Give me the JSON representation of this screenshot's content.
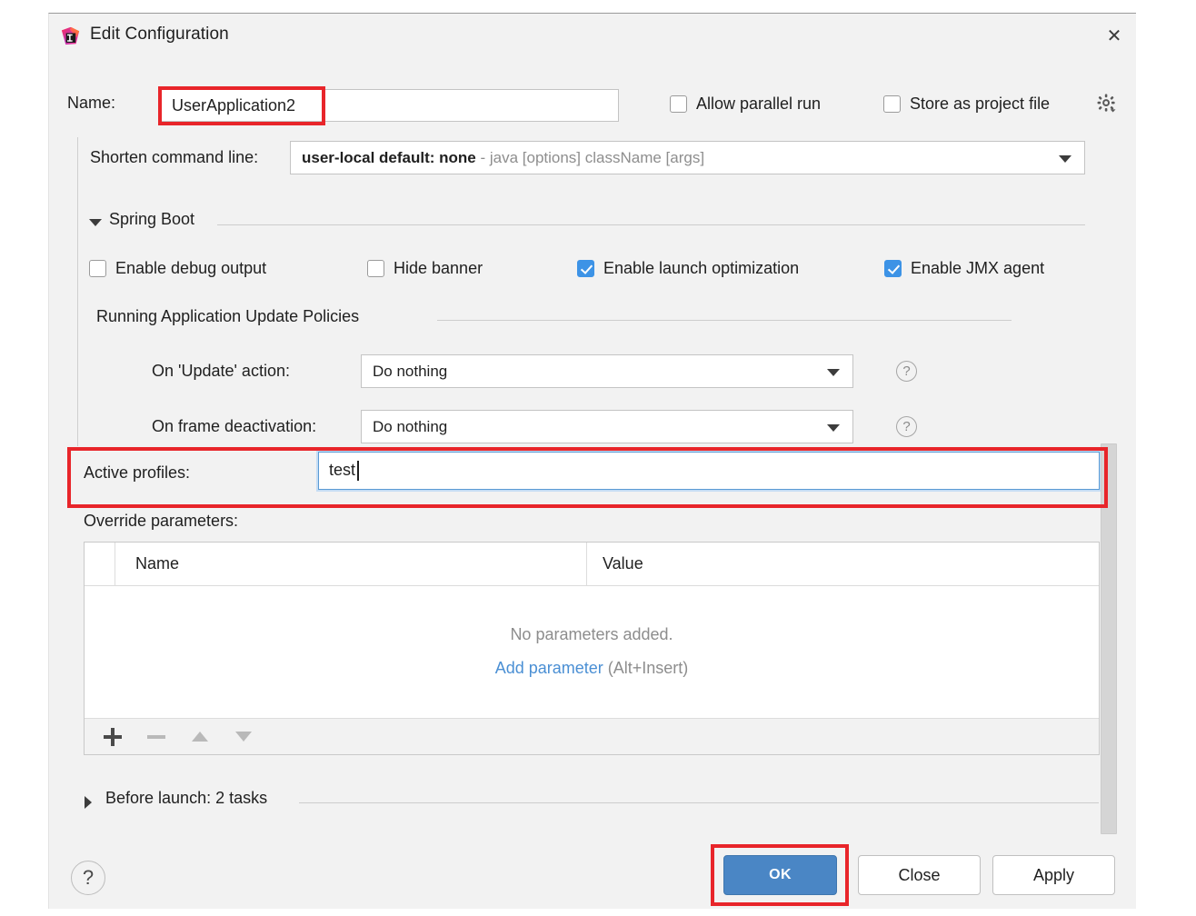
{
  "dialog": {
    "title": "Edit Configuration",
    "app_icon": "intellij-idea-icon",
    "close_label": "✕"
  },
  "name_row": {
    "label": "Name:",
    "value": "UserApplication2",
    "allow_parallel_run": {
      "label": "Allow parallel run",
      "checked": false
    },
    "store_as_project_file": {
      "label": "Store as project file",
      "checked": false
    },
    "gear_icon": "gear-icon"
  },
  "shorten_command_line": {
    "label": "Shorten command line:",
    "value_bold": "user-local default: none",
    "value_dim": " - java [options] className [args]"
  },
  "spring_boot": {
    "title": "Spring Boot",
    "expanded": true,
    "checkboxes": [
      {
        "label": "Enable debug output",
        "checked": false
      },
      {
        "label": "Hide banner",
        "checked": false
      },
      {
        "label": "Enable launch optimization",
        "checked": true
      },
      {
        "label": "Enable JMX agent",
        "checked": true
      }
    ]
  },
  "update_policies": {
    "title": "Running Application Update Policies",
    "rows": [
      {
        "label": "On 'Update' action:",
        "value": "Do nothing",
        "help": "?"
      },
      {
        "label": "On frame deactivation:",
        "value": "Do nothing",
        "help": "?"
      }
    ]
  },
  "active_profiles": {
    "label": "Active profiles:",
    "value": "test"
  },
  "override_parameters": {
    "label": "Override parameters:",
    "columns": [
      "Name",
      "Value"
    ],
    "rows": [],
    "empty_message": "No parameters added.",
    "empty_link": "Add parameter",
    "empty_shortcut": " (Alt+Insert)",
    "toolbar": [
      {
        "name": "add",
        "icon": "plus-icon",
        "enabled": true
      },
      {
        "name": "remove",
        "icon": "minus-icon",
        "enabled": false
      },
      {
        "name": "move-up",
        "icon": "triangle-up-icon",
        "enabled": false
      },
      {
        "name": "move-down",
        "icon": "triangle-down-icon",
        "enabled": false
      }
    ]
  },
  "before_launch": {
    "title": "Before launch: 2 tasks",
    "expanded": false
  },
  "footer": {
    "help_label": "?",
    "ok_label": "OK",
    "close_label": "Close",
    "apply_label": "Apply"
  },
  "colors": {
    "highlight": "#e8252a",
    "accent": "#4a86c5",
    "checkbox_checked": "#3d93e6",
    "link": "#4a8fd4",
    "dialog_bg": "#f2f2f2"
  }
}
